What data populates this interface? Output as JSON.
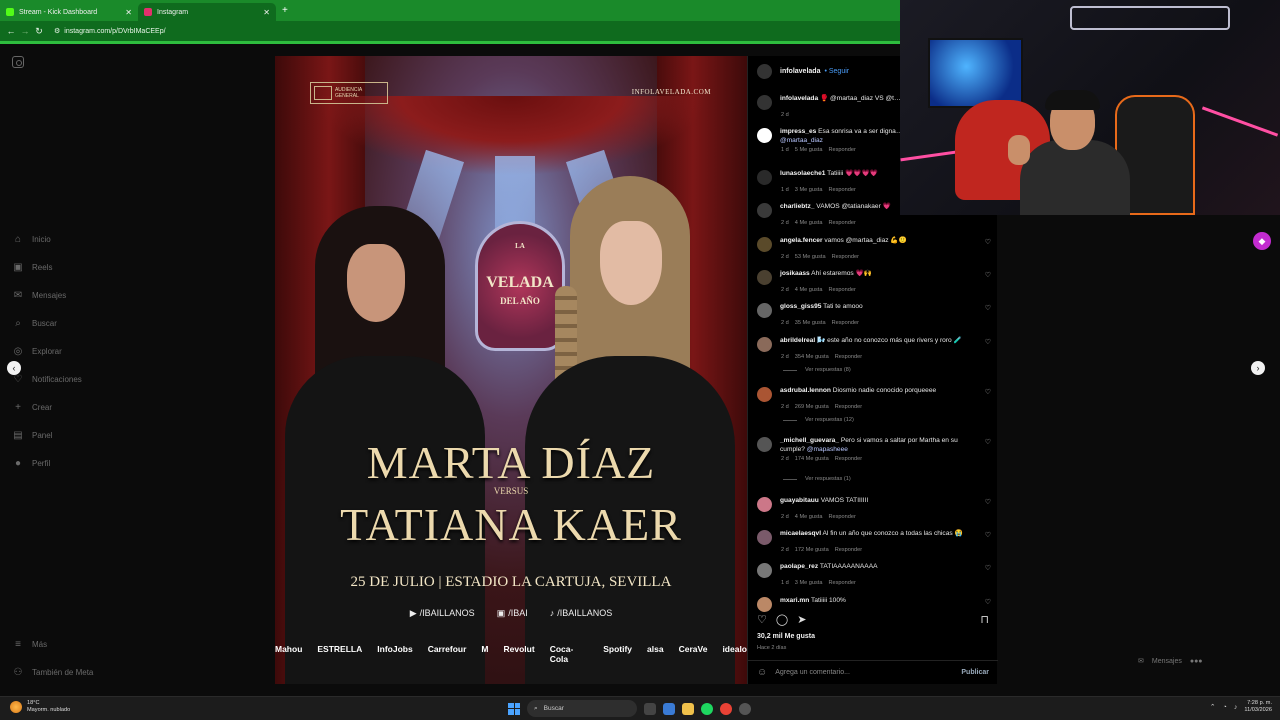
{
  "browser": {
    "tabs": [
      {
        "title": "Stream - Kick Dashboard",
        "favicon_color": "#53fc18",
        "active": false
      },
      {
        "title": "Instagram",
        "favicon_color": "#e1306c",
        "active": true
      }
    ],
    "new_tab": "+",
    "url": "instagram.com/p/DVrbIMaCEEp/"
  },
  "sidebar": {
    "items": [
      {
        "label": "Inicio",
        "icon": "home-icon",
        "glyph": "⌂"
      },
      {
        "label": "Reels",
        "icon": "reels-icon",
        "glyph": "▣"
      },
      {
        "label": "Mensajes",
        "icon": "messages-icon",
        "glyph": "✉"
      },
      {
        "label": "Buscar",
        "icon": "search-icon",
        "glyph": "⌕"
      },
      {
        "label": "Explorar",
        "icon": "explore-icon",
        "glyph": "◎"
      },
      {
        "label": "Notificaciones",
        "icon": "heart-icon",
        "glyph": "♡"
      },
      {
        "label": "Crear",
        "icon": "plus-icon",
        "glyph": "+"
      },
      {
        "label": "Panel",
        "icon": "dashboard-icon",
        "glyph": "▤"
      },
      {
        "label": "Perfil",
        "icon": "profile-icon",
        "glyph": "●"
      }
    ],
    "more": {
      "label": "Más",
      "glyph": "≡"
    },
    "meta": {
      "label": "También de Meta",
      "glyph": "⚇"
    }
  },
  "poster": {
    "badge": "AUDIENCIA GENERAL",
    "site": "INFOLAVELADA.COM",
    "logo_top": "LA",
    "logo_main": "VELADA",
    "logo_sub": "DEL AÑO",
    "name1": "MARTA DÍAZ",
    "versus": "VERSUS",
    "name2": "TATIANA KAER",
    "date": "25 DE JULIO | ESTADIO LA CARTUJA, SEVILLA",
    "socials": [
      "/IBAILLANOS",
      "/IBAI",
      "/IBAILLANOS"
    ],
    "sponsors": [
      "Mahou",
      "ESTRELLA",
      "InfoJobs",
      "Carrefour",
      "M",
      "Revolut",
      "Coca-Cola",
      "Spotify",
      "alsa",
      "CeraVe",
      "idealo"
    ]
  },
  "post": {
    "author": "infolavelada",
    "follow_label": "Seguir",
    "comments": [
      {
        "user": "infolavelada",
        "text": "🥊 @martaa_diaz VS @t…",
        "mention": "",
        "age": "2 d",
        "likes": "",
        "reply": "",
        "avatar": "#333333"
      },
      {
        "user": "impress_es",
        "text": "Esa sonrisa va a ser digna…",
        "mention": "@martaa_diaz",
        "age": "1 d",
        "likes": "5 Me gusta",
        "reply": "Responder",
        "avatar": "#ffffff"
      },
      {
        "user": "lunasolaeche1",
        "text": "Tatiiiii 💗💗💗💗",
        "mention": "",
        "age": "1 d",
        "likes": "3 Me gusta",
        "reply": "Responder",
        "avatar": "#2a2a2a"
      },
      {
        "user": "charliebtz_",
        "text": "VAMOS @tatianakaer 💗",
        "mention": "",
        "age": "2 d",
        "likes": "4 Me gusta",
        "reply": "Responder",
        "avatar": "#3a3a3a"
      },
      {
        "user": "angela.fencer",
        "text": "vamos @martaa_diaz 💪🙂",
        "mention": "",
        "age": "2 d",
        "likes": "53 Me gusta",
        "reply": "Responder",
        "avatar": "#5a4a2a"
      },
      {
        "user": "josikaass",
        "text": "Ahí estaremos 💗🙌",
        "mention": "",
        "age": "2 d",
        "likes": "4 Me gusta",
        "reply": "Responder",
        "avatar": "#4a4030"
      },
      {
        "user": "gloss_giss95",
        "text": "Tati te amooo",
        "mention": "",
        "age": "2 d",
        "likes": "35 Me gusta",
        "reply": "Responder",
        "avatar": "#666666"
      },
      {
        "user": "abrildelreal",
        "text": "🌬️ este año no conozco más que rivers y roro 🧪",
        "mention": "",
        "age": "2 d",
        "likes": "354 Me gusta",
        "reply": "Responder",
        "avatar": "#8a6a5a"
      },
      {
        "user": "asdrubal.lennon",
        "text": "Diosmio nadie conocido porqueeee",
        "mention": "",
        "age": "2 d",
        "likes": "269 Me gusta",
        "reply": "Responder",
        "avatar": "#aa5533"
      },
      {
        "user": "_michell_guevara_",
        "text": "Pero si vamos a saltar por Martha en su cumple?",
        "mention": "@mapasheee",
        "age": "2 d",
        "likes": "174 Me gusta",
        "reply": "Responder",
        "avatar": "#555555"
      },
      {
        "user": "guayabitauu",
        "text": "VAMOS TATIIIIII",
        "mention": "",
        "age": "2 d",
        "likes": "4 Me gusta",
        "reply": "Responder",
        "avatar": "#cc7788"
      },
      {
        "user": "micaelaesqvl",
        "text": "Al fin un año que conozco a todas las chicas 😭",
        "mention": "",
        "age": "2 d",
        "likes": "172 Me gusta",
        "reply": "Responder",
        "avatar": "#7a5a6a"
      },
      {
        "user": "paolape_rez",
        "text": "TATIAAAAANAAAA",
        "mention": "",
        "age": "1 d",
        "likes": "3 Me gusta",
        "reply": "Responder",
        "avatar": "#777777"
      },
      {
        "user": "mxari.mn",
        "text": "Tatiiiii 100%",
        "mention": "",
        "age": "",
        "likes": "",
        "reply": "",
        "avatar": "#bb8866"
      }
    ],
    "replies": [
      "Ver respuestas (8)",
      "Ver respuestas (12)",
      "Ver respuestas (1)"
    ],
    "likes_count": "30,2 mil Me gusta",
    "posted": "Hace 2 días",
    "comment_placeholder": "Agrega un comentario...",
    "publish_label": "Publicar"
  },
  "overlay": {
    "messages_label": "Mensajes"
  },
  "taskbar": {
    "temp": "18°C",
    "condition": "Mayorm. nublado",
    "search_label": "Buscar",
    "time": "7:28 p. m.",
    "date": "11/03/2026"
  }
}
